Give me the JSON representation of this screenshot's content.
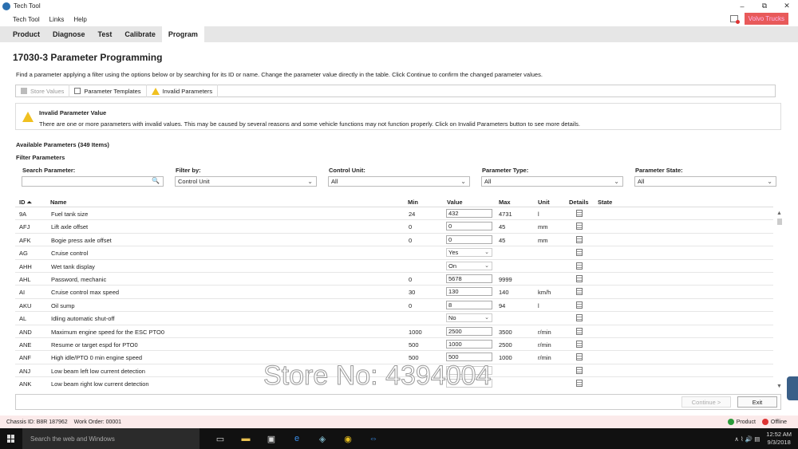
{
  "window": {
    "title": "Tech Tool",
    "minimize": "–",
    "maximize": "⧉",
    "close": "✕"
  },
  "menu": [
    "Tech Tool",
    "Links",
    "Help"
  ],
  "volvo_button": "Volvo Trucks",
  "tabs": [
    {
      "label": "Product",
      "active": false
    },
    {
      "label": "Diagnose",
      "active": false
    },
    {
      "label": "Test",
      "active": false
    },
    {
      "label": "Calibrate",
      "active": false
    },
    {
      "label": "Program",
      "active": true
    }
  ],
  "page": {
    "title": "17030-3 Parameter Programming",
    "description": "Find a parameter applying a filter using the options below or by searching for its ID or name. Change the parameter value directly in the table. Click Continue to confirm the changed parameter values."
  },
  "toolbar": {
    "store_values": "Store Values",
    "parameter_templates": "Parameter Templates",
    "invalid_parameters": "Invalid Parameters"
  },
  "warning": {
    "title": "Invalid Parameter Value",
    "text": "There are one or more parameters with invalid values. This may be caused by several reasons and some vehicle functions may not function properly. Click on Invalid Parameters button to see more details."
  },
  "available": "Available Parameters (349 Items)",
  "filters": {
    "heading": "Filter Parameters",
    "search_label": "Search Parameter:",
    "search_value": "",
    "filter_by_label": "Filter by:",
    "filter_by_value": "Control Unit",
    "control_unit_label": "Control Unit:",
    "control_unit_value": "All",
    "parameter_type_label": "Parameter Type:",
    "parameter_type_value": "All",
    "parameter_state_label": "Parameter State:",
    "parameter_state_value": "All"
  },
  "columns": {
    "id": "ID",
    "name": "Name",
    "min": "Min",
    "value": "Value",
    "max": "Max",
    "unit": "Unit",
    "details": "Details",
    "state": "State"
  },
  "rows": [
    {
      "id": "9A",
      "name": "Fuel tank size",
      "min": "24",
      "value": "432",
      "kind": "input",
      "max": "4731",
      "unit": "l"
    },
    {
      "id": "AFJ",
      "name": "Lift axle offset",
      "min": "0",
      "value": "0",
      "kind": "input",
      "max": "45",
      "unit": "mm"
    },
    {
      "id": "AFK",
      "name": "Bogie press axle offset",
      "min": "0",
      "value": "0",
      "kind": "input",
      "max": "45",
      "unit": "mm"
    },
    {
      "id": "AG",
      "name": "Cruise control",
      "min": "",
      "value": "Yes",
      "kind": "select",
      "max": "",
      "unit": ""
    },
    {
      "id": "AHH",
      "name": "Wet tank display",
      "min": "",
      "value": "On",
      "kind": "select",
      "max": "",
      "unit": ""
    },
    {
      "id": "AHL",
      "name": "Password, mechanic",
      "min": "0",
      "value": "5678",
      "kind": "input",
      "max": "9999",
      "unit": ""
    },
    {
      "id": "AI",
      "name": "Cruise control max speed",
      "min": "30",
      "value": "130",
      "kind": "input",
      "max": "140",
      "unit": "km/h"
    },
    {
      "id": "AKU",
      "name": "Oil sump",
      "min": "0",
      "value": "8",
      "kind": "input",
      "max": "94",
      "unit": "l"
    },
    {
      "id": "AL",
      "name": "Idling automatic shut-off",
      "min": "",
      "value": "No",
      "kind": "select",
      "max": "",
      "unit": ""
    },
    {
      "id": "AND",
      "name": "Maximum engine speed for the ESC PTO0",
      "min": "1000",
      "value": "2500",
      "kind": "input",
      "max": "3500",
      "unit": "r/min"
    },
    {
      "id": "ANE",
      "name": "Resume or target espd for PTO0",
      "min": "500",
      "value": "1000",
      "kind": "input",
      "max": "2500",
      "unit": "r/min"
    },
    {
      "id": "ANF",
      "name": "High idle/PTO 0 min engine speed",
      "min": "500",
      "value": "500",
      "kind": "input",
      "max": "1000",
      "unit": "r/min"
    },
    {
      "id": "ANJ",
      "name": "Low beam left low current detection",
      "min": "",
      "value": "",
      "kind": "select",
      "max": "",
      "unit": ""
    },
    {
      "id": "ANK",
      "name": "Low beam right low current detection",
      "min": "",
      "value": "",
      "kind": "select",
      "max": "",
      "unit": ""
    }
  ],
  "buttons": {
    "continue": "Continue >",
    "exit": "Exit"
  },
  "status": {
    "chassis": "Chassis ID: B8R 187962",
    "work_order": "Work Order: 00001",
    "product": "Product",
    "offline": "Offline"
  },
  "taskbar": {
    "search_placeholder": "Search the web and Windows",
    "time": "12:52 AM",
    "date": "9/3/2018"
  },
  "watermark": "Store No: 4394004",
  "colors": {
    "volvo_red": "#e85a5a",
    "warning_yellow": "#f0c020",
    "status_bg": "#fbeaea",
    "taskbar": "#111111"
  }
}
